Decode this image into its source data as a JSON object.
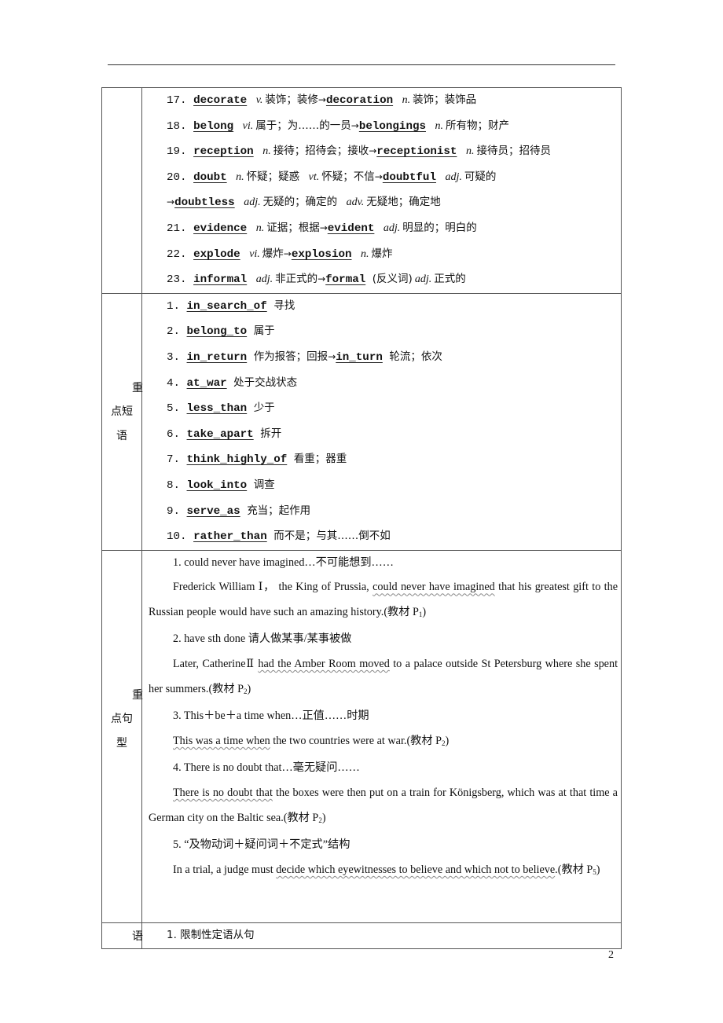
{
  "page": {
    "page_number": "2"
  },
  "vocabulary": {
    "items": [
      {
        "num": "17.",
        "word": "decorate",
        "pos": "v.",
        "meaning": "装饰；装修",
        "arrow": "→",
        "derived": "decoration",
        "derived_pos": "n.",
        "derived_meaning": "装饰；装饰品"
      },
      {
        "num": "18.",
        "word": "belong",
        "pos": "vi.",
        "meaning": "属于；为……的一员",
        "arrow": "→",
        "derived": "belongings",
        "derived_pos": "n.",
        "derived_meaning": "所有物；财产"
      },
      {
        "num": "19.",
        "word": "reception",
        "pos": "n.",
        "meaning": "接待；招待会；接收",
        "arrow": "→",
        "derived": "receptionist",
        "derived_pos": "n.",
        "derived_meaning": "接待员；招待员"
      },
      {
        "num": "20.",
        "word": "doubt",
        "pos": "n.",
        "meaning": "怀疑；疑惑",
        "pos2": "vt.",
        "meaning2": "怀疑；不信",
        "arrow": "→",
        "derived": "doubtful",
        "derived_pos": "adj.",
        "derived_meaning": "可疑的"
      },
      {
        "arrow": "→",
        "derived": "doubtless",
        "derived_pos": "adj.",
        "derived_meaning": "无疑的；确定的",
        "pos2": "adv.",
        "meaning2": "无疑地；确定地"
      },
      {
        "num": "21.",
        "word": "evidence",
        "pos": "n.",
        "meaning": "证据；根据",
        "arrow": "→",
        "derived": "evident",
        "derived_pos": "adj.",
        "derived_meaning": "明显的；明白的"
      },
      {
        "num": "22.",
        "word": "explode",
        "pos": "vi.",
        "meaning": "爆炸",
        "arrow": "→",
        "derived": "explosion",
        "derived_pos": "n.",
        "derived_meaning": "爆炸"
      },
      {
        "num": "23.",
        "word": "informal",
        "pos": "adj.",
        "meaning": "非正式的",
        "arrow": "→",
        "derived": "formal",
        "note": "(反义词)",
        "derived_pos": "adj.",
        "derived_meaning": "正式的"
      }
    ]
  },
  "phrases": {
    "label_chars": [
      "重",
      "点短",
      "语"
    ],
    "items": [
      {
        "num": "1.",
        "phrase": "in_search_of",
        "meaning": "寻找"
      },
      {
        "num": "2.",
        "phrase": "belong_to",
        "meaning": "属于"
      },
      {
        "num": "3.",
        "phrase": "in_return",
        "meaning": "作为报答；回报",
        "arrow": "→",
        "phrase2": "in_turn",
        "meaning2": "轮流；依次"
      },
      {
        "num": "4.",
        "phrase": "at_war",
        "meaning": "处于交战状态"
      },
      {
        "num": "5.",
        "phrase": "less_than",
        "meaning": "少于"
      },
      {
        "num": "6.",
        "phrase": "take_apart",
        "meaning": "拆开"
      },
      {
        "num": "7.",
        "phrase": "think_highly_of",
        "meaning": "看重；器重"
      },
      {
        "num": "8.",
        "phrase": "look_into",
        "meaning": "调查"
      },
      {
        "num": "9.",
        "phrase": "serve_as",
        "meaning": "充当；起作用"
      },
      {
        "num": "10.",
        "phrase": "rather_than",
        "meaning": "而不是；与其……倒不如"
      }
    ]
  },
  "sentences": {
    "label_chars": [
      "重",
      "点句",
      "型"
    ],
    "items": [
      {
        "heading": "1. could never have imagined…不可能想到……",
        "pre": "Frederick William Ⅰ， the King of Prussia, ",
        "hl": "could never have imagined",
        "post": " that his greatest gift to the Russian people would have such an amazing history.(教材 P",
        "sub": "1",
        "end": ")"
      },
      {
        "heading": "2. have sth done 请人做某事/某事被做",
        "pre": "Later, CatherineⅡ ",
        "hl": "had the Amber Room moved",
        "post": " to a palace outside St Petersburg where she spent her summers.(教材 P",
        "sub": "2",
        "end": ")"
      },
      {
        "heading": "3. This＋be＋a time when…正值……时期",
        "pre": "",
        "hl": "This was a time when",
        "post": " the two countries were at war.(教材 P",
        "sub": "2",
        "end": ")"
      },
      {
        "heading": "4. There is no doubt that…毫无疑问……",
        "pre": "",
        "hl": "There is no doubt that",
        "post": " the boxes were then put on a train for Königsberg, which was at that time a German city on the Baltic sea.(教材 P",
        "sub": "2",
        "end": ")"
      },
      {
        "heading": "5. “及物动词＋疑问词＋不定式”结构",
        "pre": "In a trial, a judge must ",
        "hl": "decide which eyewitnesses to believe and which not to believe",
        "post": ".(教材 P",
        "sub": "5",
        "end": ")"
      }
    ]
  },
  "grammar": {
    "label_char": "语",
    "items": [
      {
        "text": "1. 限制性定语从句"
      }
    ]
  }
}
